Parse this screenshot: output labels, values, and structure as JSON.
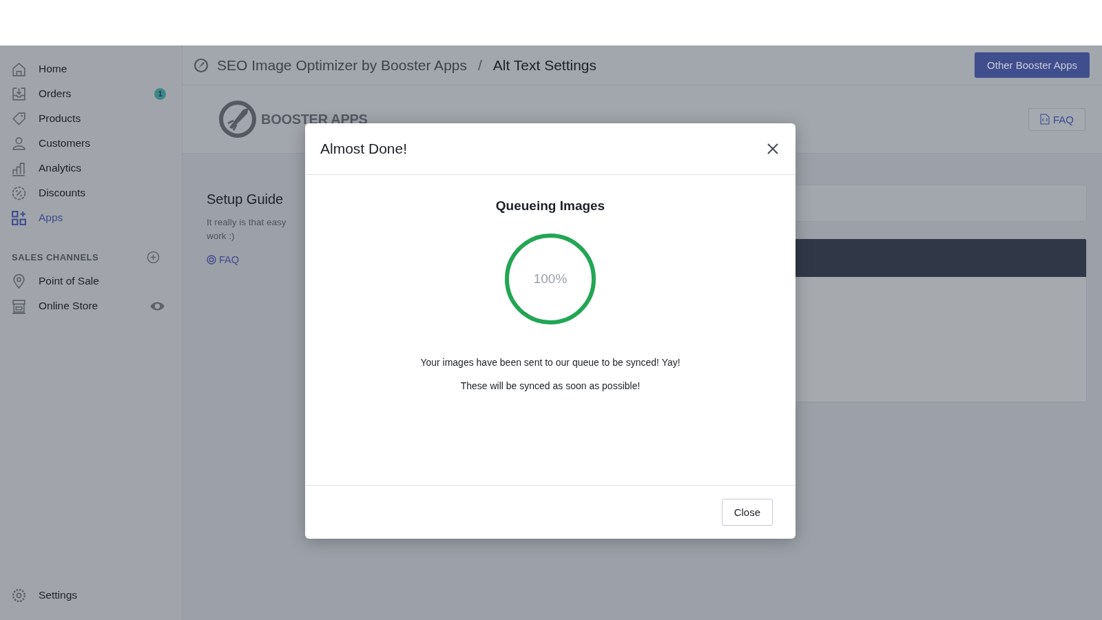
{
  "sidebar": {
    "items": [
      {
        "label": "Home",
        "selected": false
      },
      {
        "label": "Orders",
        "selected": false,
        "badge": "1"
      },
      {
        "label": "Products",
        "selected": false
      },
      {
        "label": "Customers",
        "selected": false
      },
      {
        "label": "Analytics",
        "selected": false
      },
      {
        "label": "Discounts",
        "selected": false
      },
      {
        "label": "Apps",
        "selected": true
      }
    ],
    "section_title": "SALES CHANNELS",
    "channels": [
      {
        "label": "Point of Sale"
      },
      {
        "label": "Online Store"
      }
    ],
    "footer_item": {
      "label": "Settings"
    }
  },
  "header": {
    "breadcrumb": [
      "SEO Image Optimizer by Booster Apps",
      "Alt Text Settings"
    ],
    "separator": "/",
    "action": "Other Booster Apps"
  },
  "app_header": {
    "logo_text": "BOOSTER APPS",
    "faq": "FAQ"
  },
  "setup_guide": {
    "title": "Setup Guide",
    "text_lines": [
      "It really is that easy",
      "work :)"
    ],
    "link": "FAQ"
  },
  "modal": {
    "title": "Almost Done!",
    "heading": "Queueing Images",
    "progress": {
      "level": 1,
      "reading": "100%"
    },
    "messages": [
      "Your images have been sent to our queue to be synced! Yay!",
      "These will be synced as soon as possible!"
    ],
    "button": "Close"
  }
}
